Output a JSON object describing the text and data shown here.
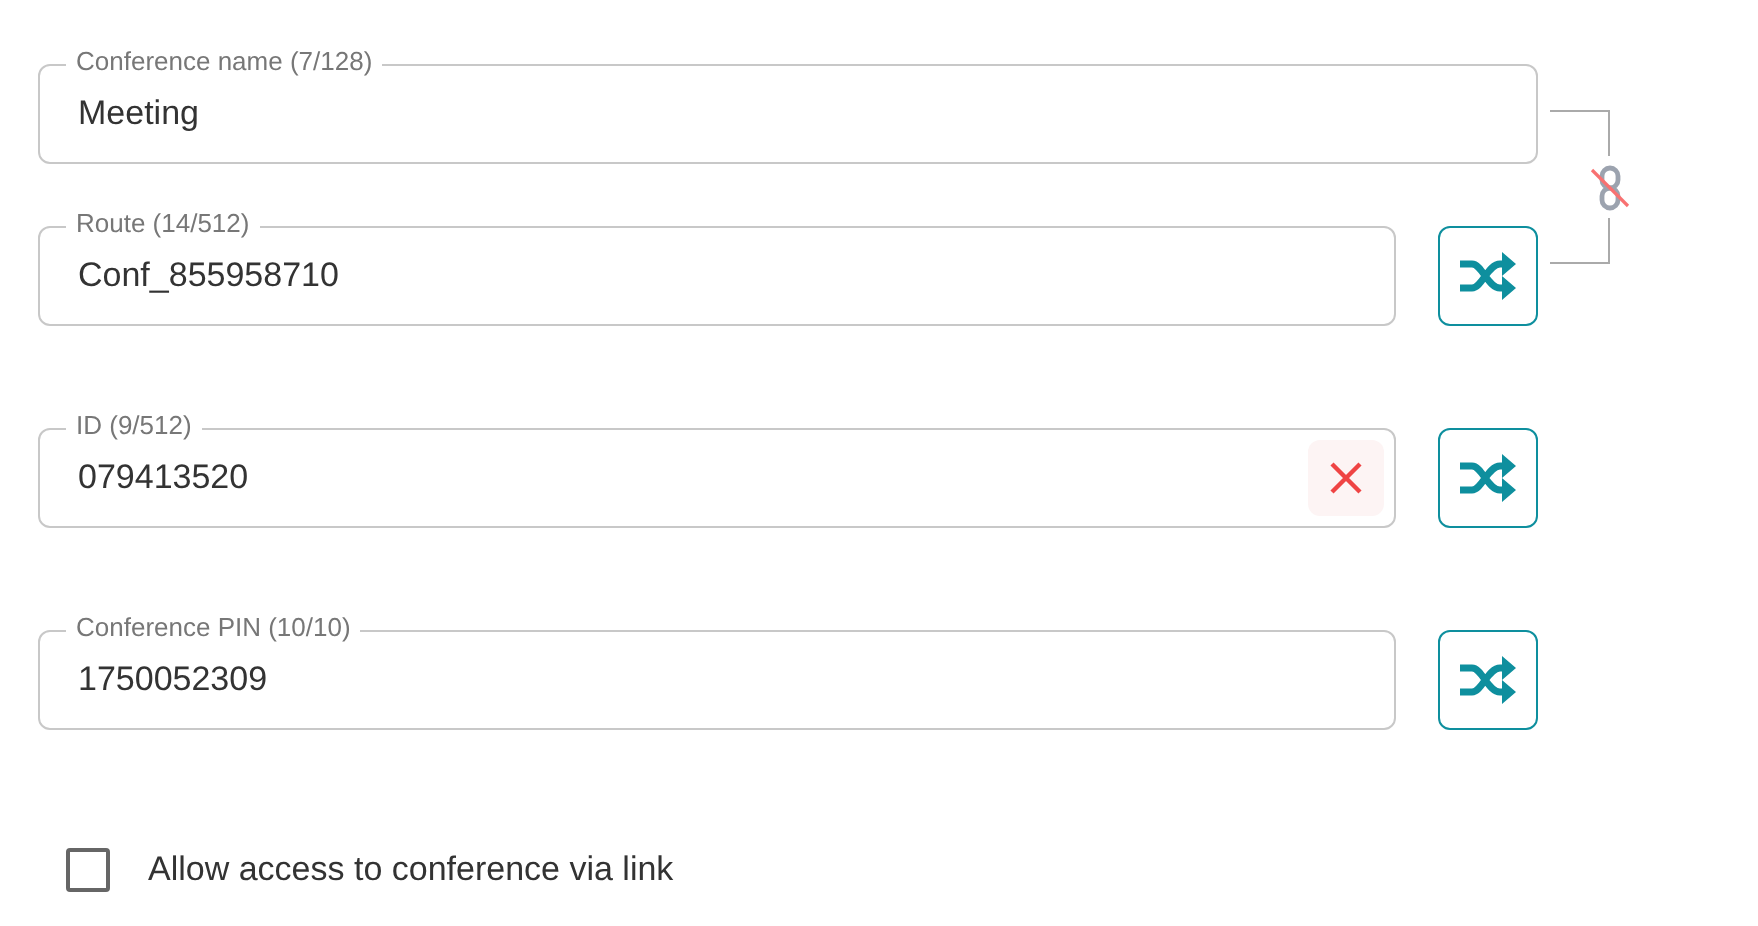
{
  "linked_group": {
    "linked": false,
    "fields": [
      {
        "label": "Conference name (7/128)",
        "value": "Meeting",
        "shuffle": false,
        "clearable": false
      },
      {
        "label": "Route (14/512)",
        "value": "Conf_855958710",
        "shuffle": true,
        "clearable": false
      }
    ]
  },
  "fields": [
    {
      "label": "ID (9/512)",
      "value": "079413520",
      "shuffle": true,
      "clearable": true
    },
    {
      "label": "Conference PIN (10/10)",
      "value": "1750052309",
      "shuffle": true,
      "clearable": false
    }
  ],
  "access_checkbox": {
    "label": "Allow access to conference via link",
    "checked": false
  }
}
